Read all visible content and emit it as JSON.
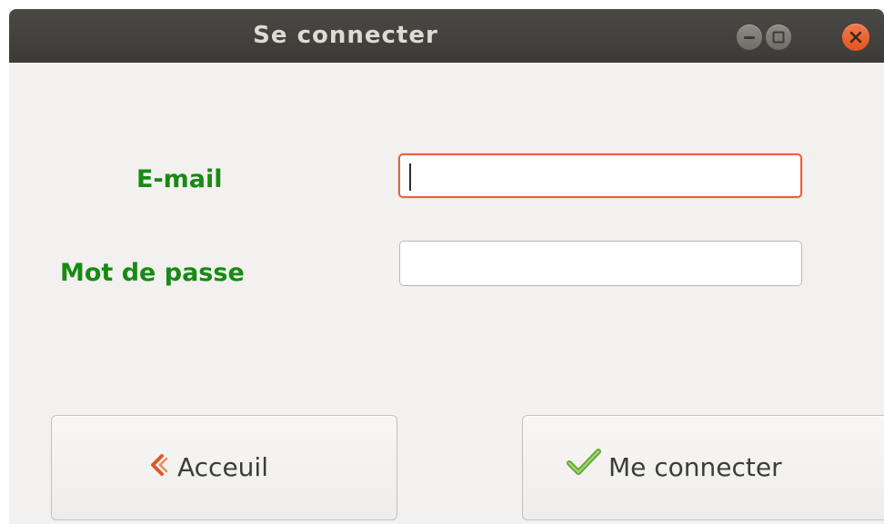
{
  "window": {
    "title": "Se connecter",
    "controls": {
      "minimize": "minimize-icon",
      "maximize": "maximize-icon",
      "close": "close-icon"
    }
  },
  "form": {
    "email_label": "E-mail",
    "email_value": "",
    "password_label": "Mot de passe",
    "password_value": ""
  },
  "buttons": {
    "home_label": "Acceuil",
    "home_icon": "chevron-left-icon",
    "connect_label": "Me connecter",
    "connect_icon": "checkmark-icon"
  },
  "colors": {
    "label_green": "#178a12",
    "focus_orange": "#e5633a",
    "close_orange": "#e2531f",
    "checkmark_green": "#6ab33a"
  }
}
